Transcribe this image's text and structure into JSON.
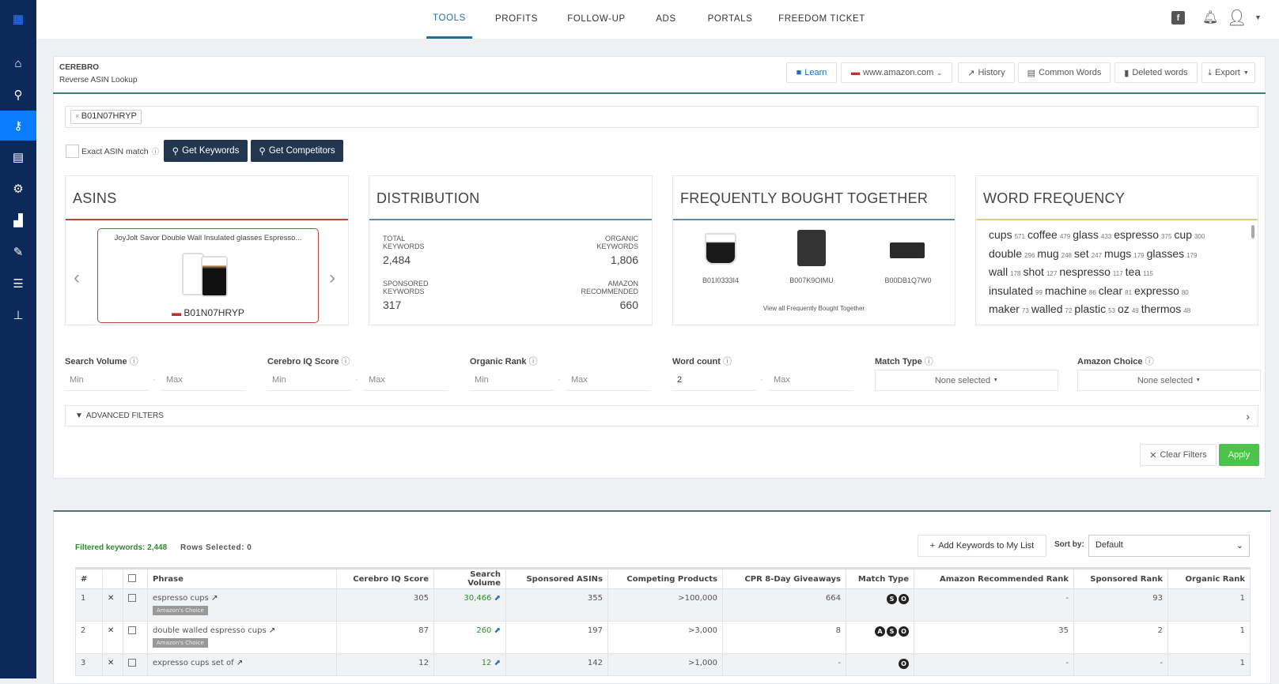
{
  "nav": {
    "tabs": [
      "TOOLS",
      "PROFITS",
      "FOLLOW-UP",
      "ADS",
      "PORTALS",
      "FREEDOM TICKET"
    ],
    "active": "TOOLS"
  },
  "sidebar": {
    "icons": [
      "logo-icon",
      "home-icon",
      "search-icon",
      "cerebro-icon",
      "listing-icon",
      "gears-icon",
      "analytics-icon",
      "marketing-icon",
      "academy-icon",
      "pin-icon"
    ],
    "active": "cerebro-icon"
  },
  "header": {
    "title": "CEREBRO",
    "subtitle": "Reverse ASIN Lookup",
    "learn": "Learn",
    "marketplace": "www.amazon.com",
    "history": "History",
    "common_words": "Common Words",
    "deleted_words": "Deleted words",
    "export": "Export"
  },
  "search": {
    "asin_tag": "B01N07HRYP",
    "exact_match": "Exact ASIN match",
    "get_keywords": "Get Keywords",
    "get_competitors": "Get Competitors"
  },
  "asins": {
    "title": "ASINS",
    "product_title": "JoyJolt Savor Double Wall Insulated glasses Espresso...",
    "asin": "B01N07HRYP"
  },
  "distribution": {
    "title": "DISTRIBUTION",
    "total_label": "TOTAL KEYWORDS",
    "total": "2,484",
    "organic_label": "ORGANIC KEYWORDS",
    "organic": "1,806",
    "sponsored_label": "SPONSORED KEYWORDS",
    "sponsored": "317",
    "amazon_label": "AMAZON RECOMMENDED",
    "amazon": "660"
  },
  "fbt": {
    "title": "FREQUENTLY BOUGHT TOGETHER",
    "asins": [
      "B01I0333I4",
      "B007K9OIMU",
      "B00DB1Q7W0"
    ],
    "view_all": "View all Frequently Bought Together"
  },
  "word_frequency": {
    "title": "WORD FREQUENCY",
    "words": [
      [
        "cups",
        "571"
      ],
      [
        "coffee",
        "479"
      ],
      [
        "glass",
        "433"
      ],
      [
        "espresso",
        "375"
      ],
      [
        "cup",
        "300"
      ],
      [
        "double",
        "296"
      ],
      [
        "mug",
        "248"
      ],
      [
        "set",
        "247"
      ],
      [
        "mugs",
        "179"
      ],
      [
        "glasses",
        "179"
      ],
      [
        "wall",
        "178"
      ],
      [
        "shot",
        "127"
      ],
      [
        "nespresso",
        "117"
      ],
      [
        "tea",
        "115"
      ],
      [
        "insulated",
        "99"
      ],
      [
        "machine",
        "86"
      ],
      [
        "clear",
        "81"
      ],
      [
        "expresso",
        "80"
      ],
      [
        "maker",
        "73"
      ],
      [
        "walled",
        "72"
      ],
      [
        "plastic",
        "53"
      ],
      [
        "oz",
        "49"
      ],
      [
        "thermos",
        "48"
      ]
    ]
  },
  "filters": {
    "labels": [
      "Search Volume",
      "Cerebro IQ Score",
      "Organic Rank",
      "Word count",
      "Match Type",
      "Amazon Choice"
    ],
    "min": "Min",
    "max": "Max",
    "word_count_min": "2",
    "none_selected": "None selected",
    "advanced": "ADVANCED FILTERS",
    "clear": "Clear Filters",
    "apply": "Apply"
  },
  "results": {
    "filtered": "Filtered keywords: 2,448",
    "rows_selected": "Rows Selected: 0",
    "add_keywords": "Add Keywords to My List",
    "sort_label": "Sort by:",
    "sort_value": "Default",
    "badge": "Amazon's Choice",
    "columns": [
      "#",
      "",
      "",
      "Phrase",
      "Cerebro IQ Score",
      "Search Volume",
      "Sponsored ASINs",
      "Competing Products",
      "CPR 8-Day Giveaways",
      "Match Type",
      "Amazon Recommended Rank",
      "Sponsored Rank",
      "Organic Rank"
    ],
    "rows": [
      {
        "n": "1",
        "phrase": "espresso cups",
        "choice": true,
        "iq": "305",
        "sv": "30,466",
        "sa": "355",
        "cp": ">100,000",
        "cpr": "664",
        "mt": [
          "S",
          "O"
        ],
        "arr": "-",
        "sr": "93",
        "or": "1"
      },
      {
        "n": "2",
        "phrase": "double walled espresso cups",
        "choice": true,
        "iq": "87",
        "sv": "260",
        "sa": "197",
        "cp": ">3,000",
        "cpr": "8",
        "mt": [
          "A",
          "S",
          "O"
        ],
        "arr": "35",
        "sr": "2",
        "or": "1"
      },
      {
        "n": "3",
        "phrase": "expresso cups set of",
        "choice": false,
        "iq": "12",
        "sv": "12",
        "sa": "142",
        "cp": ">1,000",
        "cpr": "-",
        "mt": [
          "O"
        ],
        "arr": "-",
        "sr": "-",
        "or": "1"
      }
    ]
  }
}
